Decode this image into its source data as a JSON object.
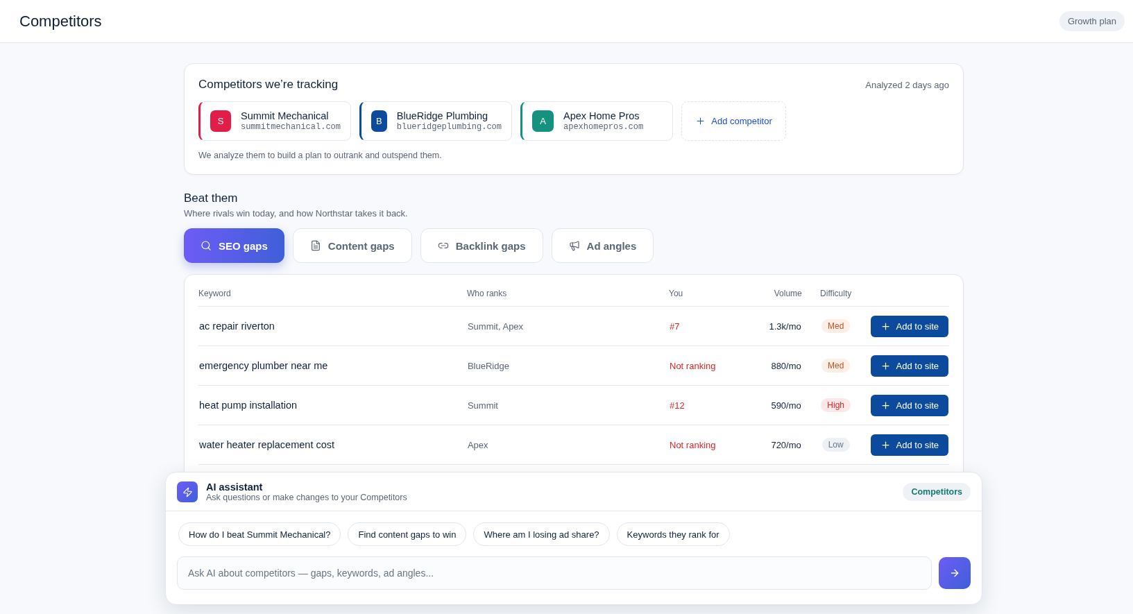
{
  "header": {
    "title": "Competitors",
    "plan_button": "Growth plan"
  },
  "tracking": {
    "title": "Competitors we’re tracking",
    "analyzed": "Analyzed 2 days ago",
    "note": "We analyze them to build a plan to outrank and outspend them.",
    "add_button": "Add competitor",
    "competitors": [
      {
        "initial": "S",
        "name": "Summit Mechanical",
        "domain": "summitmechanical.com",
        "color": "#e11d48"
      },
      {
        "initial": "B",
        "name": "BlueRidge Plumbing",
        "domain": "blueridgeplumbing.com",
        "color": "#0b4a9c"
      },
      {
        "initial": "A",
        "name": "Apex Home Pros",
        "domain": "apexhomepros.com",
        "color": "#14917f"
      }
    ]
  },
  "beat": {
    "title": "Beat them",
    "subtitle": "Where rivals win today, and how Northstar takes it back.",
    "tabs": [
      {
        "label": "SEO gaps",
        "selected": true
      },
      {
        "label": "Content gaps",
        "selected": false
      },
      {
        "label": "Backlink gaps",
        "selected": false
      },
      {
        "label": "Ad angles",
        "selected": false
      }
    ]
  },
  "table": {
    "columns": [
      "Keyword",
      "Who ranks",
      "You",
      "Volume",
      "Difficulty"
    ],
    "rows": [
      {
        "keyword": "ac repair riverton",
        "who_ranks": "Summit, Apex",
        "you": "#7",
        "volume": "1.3k/mo",
        "difficulty": {
          "label": "Med",
          "kind": "med"
        },
        "action": "Add to site"
      },
      {
        "keyword": "emergency plumber near me",
        "who_ranks": "BlueRidge",
        "you": "Not ranking",
        "volume": "880/mo",
        "difficulty": {
          "label": "Med",
          "kind": "med"
        },
        "action": "Add to site"
      },
      {
        "keyword": "heat pump installation",
        "who_ranks": "Summit",
        "you": "#12",
        "volume": "590/mo",
        "difficulty": {
          "label": "High",
          "kind": "high"
        },
        "action": "Add to site"
      },
      {
        "keyword": "water heater replacement cost",
        "who_ranks": "Apex",
        "you": "Not ranking",
        "volume": "720/mo",
        "difficulty": {
          "label": "Low",
          "kind": "low"
        },
        "action": "Add to site"
      }
    ]
  },
  "assistant": {
    "title": "AI assistant",
    "subtitle": "Ask questions or make changes to your Competitors",
    "context": "Competitors",
    "suggestions": [
      "How do I beat Summit Mechanical?",
      "Find content gaps to win",
      "Where am I losing ad share?",
      "Keywords they rank for"
    ],
    "placeholder": "Ask AI about competitors — gaps, keywords, ad angles..."
  }
}
